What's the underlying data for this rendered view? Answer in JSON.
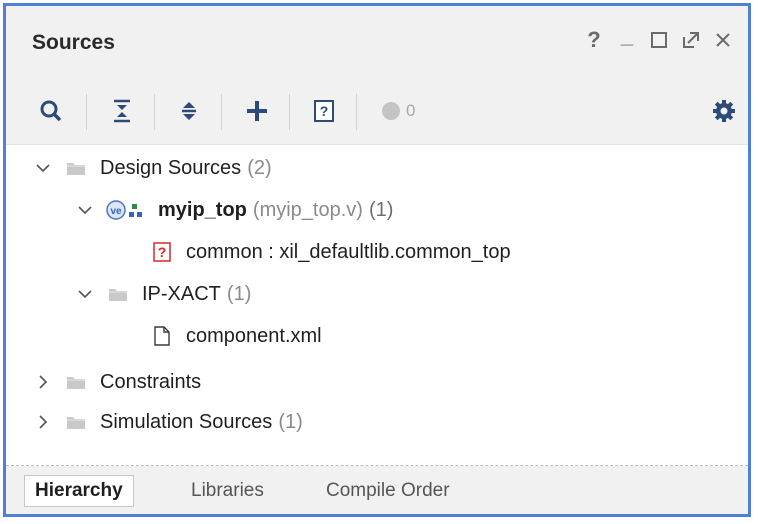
{
  "panel": {
    "title": "Sources",
    "controls": {
      "help": "?",
      "minimize": "_"
    }
  },
  "toolbar": {
    "count": "0",
    "buttons": [
      "search-icon",
      "collapse-all-icon",
      "expand-all-icon",
      "add-icon",
      "unknown-icon",
      "status-dot-icon",
      "gear-icon"
    ]
  },
  "tree": {
    "design_sources": {
      "label": "Design Sources",
      "count": "(2)"
    },
    "myip_top": {
      "label": "myip_top",
      "file": "(myip_top.v)",
      "count": "(1)"
    },
    "common": {
      "label": "common : xil_defaultlib.common_top"
    },
    "ip_xact": {
      "label": "IP-XACT",
      "count": "(1)"
    },
    "component": {
      "label": "component.xml"
    },
    "constraints": {
      "label": "Constraints"
    },
    "simulation_sources": {
      "label": "Simulation Sources",
      "count": "(1)"
    }
  },
  "tabs": [
    {
      "label": "Hierarchy",
      "active": true
    },
    {
      "label": "Libraries",
      "active": false
    },
    {
      "label": "Compile Order",
      "active": false
    }
  ],
  "colors": {
    "accent": "#4f7fd6",
    "panel_bg": "#f1f1f1",
    "icon_gray": "#595959",
    "error_red": "#d62828"
  }
}
